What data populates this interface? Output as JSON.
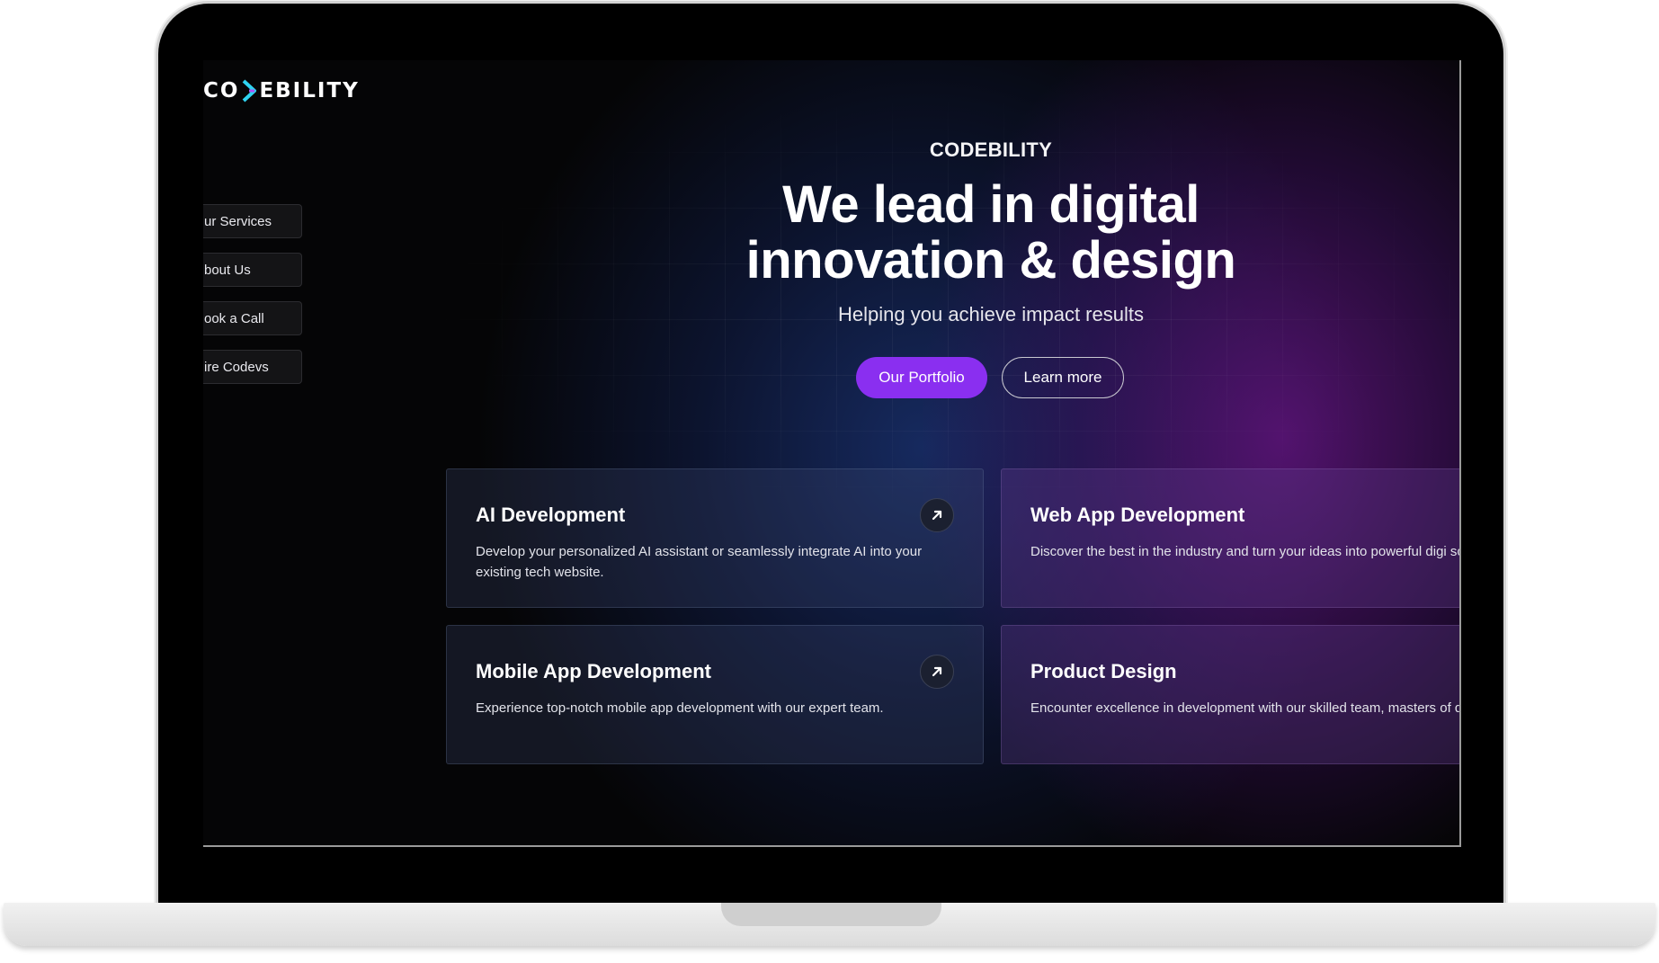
{
  "brand": {
    "logo_text_left": "CO",
    "logo_text_right": "EBILITY",
    "accent": "#8a2ff0",
    "logo_accent": "#2fd3f0"
  },
  "side_nav": {
    "items": [
      {
        "label": "ur Services"
      },
      {
        "label": "bout Us"
      },
      {
        "label": "ook a Call"
      },
      {
        "label": "ire Codevs"
      }
    ]
  },
  "hero": {
    "eyebrow": "CODEBILITY",
    "title_line1": "We lead in digital",
    "title_line2": "innovation & design",
    "subtitle": "Helping you achieve impact results",
    "primary_button": "Our Portfolio",
    "secondary_button": "Learn more"
  },
  "services": [
    {
      "title": "AI Development",
      "description": "Develop your personalized AI assistant or seamlessly integrate AI into your existing tech website.",
      "icon": "arrow-up-right-icon"
    },
    {
      "title": "Web App Development",
      "description": "Discover the best in the industry and turn your ideas into powerful digi solutions."
    },
    {
      "title": "Mobile App Development",
      "description": "Experience top-notch mobile app development with our expert team.",
      "icon": "arrow-up-right-icon"
    },
    {
      "title": "Product Design",
      "description": "Encounter excellence in development with our skilled team, masters of design."
    }
  ]
}
